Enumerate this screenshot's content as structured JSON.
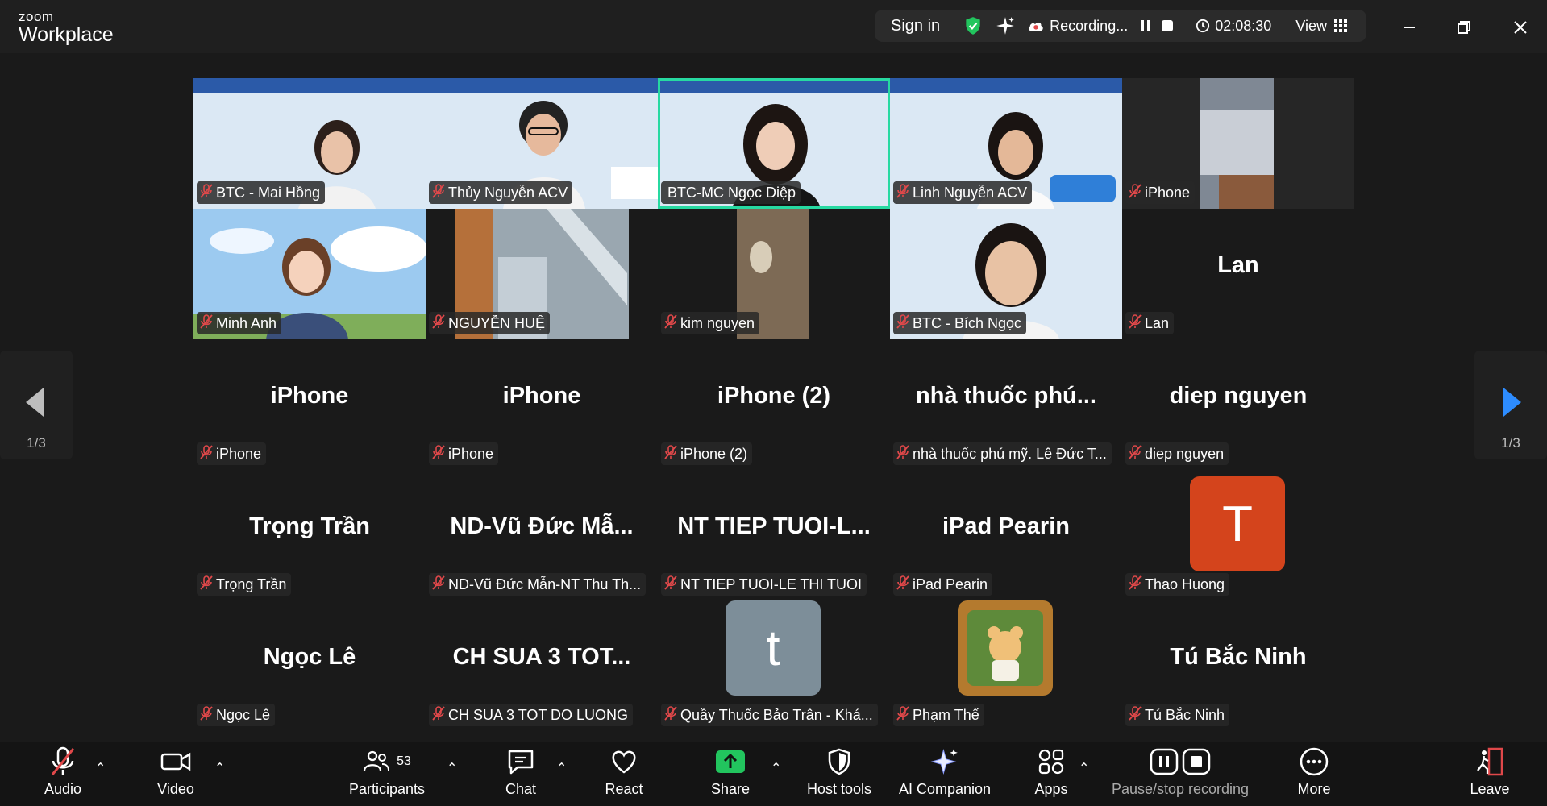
{
  "app": {
    "brand_small": "zoom",
    "brand_large": "Workplace"
  },
  "topbar": {
    "signin": "Sign in",
    "recording": "Recording...",
    "timer": "02:08:30",
    "view": "View"
  },
  "colors": {
    "active_speaker": "#27d9a1",
    "share_green": "#22c55e",
    "muted_red": "#e0484a",
    "avatar_T": "#d4441c",
    "avatar_t": "#7d8e99"
  },
  "tiles": [
    {
      "big": "",
      "label": "BTC - Mai Hồng"
    },
    {
      "big": "",
      "label": "Thủy Nguyễn ACV"
    },
    {
      "big": "",
      "label": "BTC-MC Ngọc Diệp"
    },
    {
      "big": "",
      "label": "Linh Nguyễn ACV"
    },
    {
      "big": "",
      "label": "iPhone"
    },
    {
      "big": "",
      "label": "Minh Anh"
    },
    {
      "big": "",
      "label": "NGUYỄN HUỆ"
    },
    {
      "big": "",
      "label": "kim nguyen"
    },
    {
      "big": "",
      "label": "BTC - Bích Ngọc"
    },
    {
      "big": "Lan",
      "label": "Lan"
    },
    {
      "big": "iPhone",
      "label": "iPhone"
    },
    {
      "big": "iPhone",
      "label": "iPhone"
    },
    {
      "big": "iPhone (2)",
      "label": "iPhone (2)"
    },
    {
      "big": "nhà thuốc phú...",
      "label": "nhà thuốc phú mỹ. Lê Đức T..."
    },
    {
      "big": "diep nguyen",
      "label": "diep nguyen"
    },
    {
      "big": "Trọng Trần",
      "label": "Trọng Trần"
    },
    {
      "big": "ND-Vũ Đức Mẫ...",
      "label": "ND-Vũ Đức Mẫn-NT Thu Th..."
    },
    {
      "big": "NT TIEP TUOI-L...",
      "label": "NT TIEP TUOI-LE THI TUOI"
    },
    {
      "big": "iPad Pearin",
      "label": "iPad Pearin"
    },
    {
      "big": "",
      "label": "Thao Huong",
      "avatar": "T"
    },
    {
      "big": "Ngọc Lê",
      "label": "Ngọc Lê"
    },
    {
      "big": "CH SUA 3 TOT...",
      "label": "CH SUA 3 TOT DO LUONG"
    },
    {
      "big": "",
      "label": "Quầy Thuốc Bảo Trân - Khá...",
      "avatar": "t"
    },
    {
      "big": "",
      "label": "Phạm Thế"
    },
    {
      "big": "Tú Bắc Ninh",
      "label": "Tú Bắc Ninh"
    }
  ],
  "pager": {
    "left": "1/3",
    "right": "1/3"
  },
  "toolbar": {
    "audio": "Audio",
    "video": "Video",
    "participants": "Participants",
    "participants_count": "53",
    "chat": "Chat",
    "react": "React",
    "share": "Share",
    "host_tools": "Host tools",
    "ai_companion": "AI Companion",
    "apps": "Apps",
    "pause_stop_recording": "Pause/stop recording",
    "more": "More",
    "leave": "Leave"
  }
}
